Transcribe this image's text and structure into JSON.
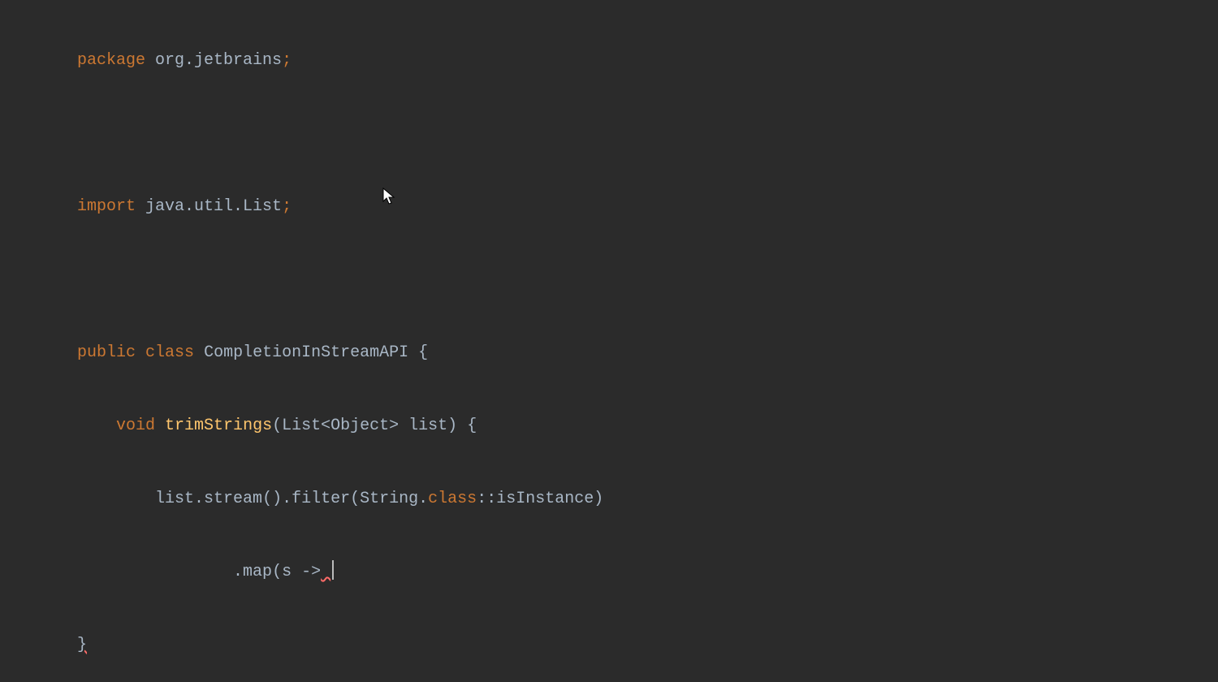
{
  "code": {
    "kw_package": "package",
    "package_name": "org.jetbrains",
    "semi": ";",
    "kw_import": "import",
    "import_name": "java.util.List",
    "kw_public": "public",
    "kw_class": "class",
    "class_name": "CompletionInStreamAPI",
    "open_brace": "{",
    "kw_void": "void",
    "method_name": "trimStrings",
    "param_open": "(",
    "param_type": "List<Object>",
    "param_name": "list",
    "param_close": ")",
    "body_open": "{",
    "var_list": "list",
    "dot": ".",
    "stream": "stream",
    "call_open": "(",
    "call_close": ")",
    "filter": "filter",
    "string_class": "String",
    "kw_class_ref": "class",
    "colons": "::",
    "isInstance": "isInstance",
    "map_call": "map",
    "lambda_param": "s",
    "arrow": "->",
    "close_brace": "}",
    "space": " ",
    "indent1": "    ",
    "indent2": "        ",
    "indent3": "                "
  }
}
